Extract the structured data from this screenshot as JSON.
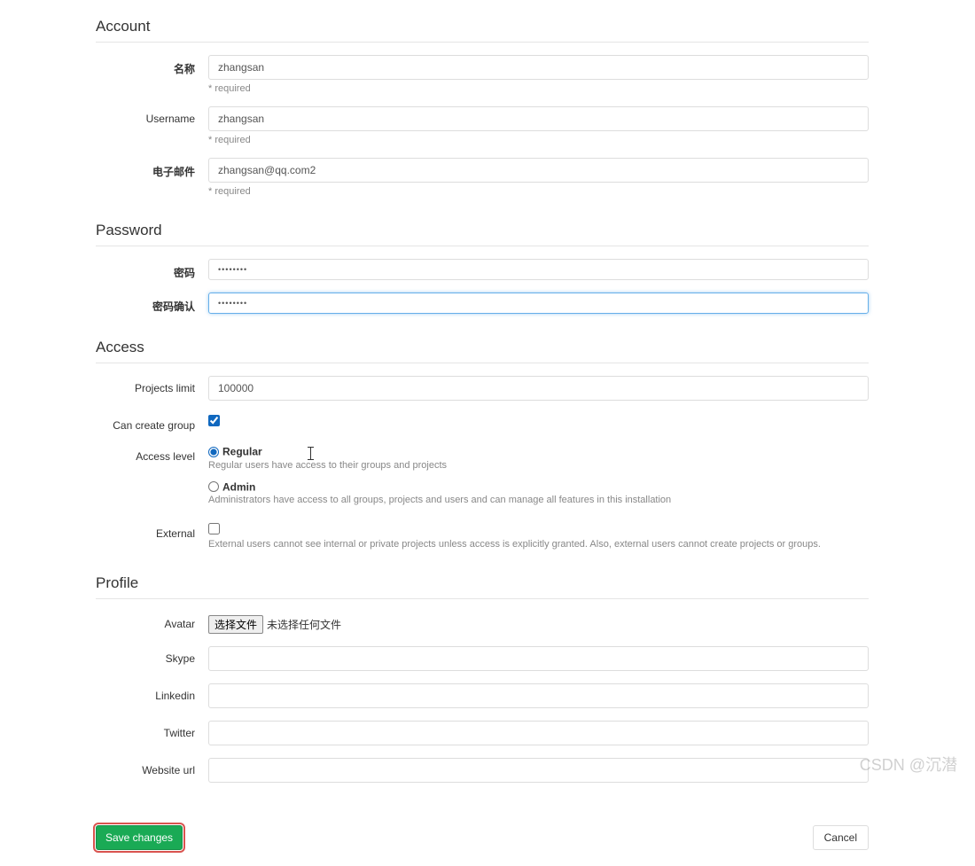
{
  "sections": {
    "account": {
      "title": "Account",
      "name": {
        "label": "名称",
        "value": "zhangsan",
        "required": "* required"
      },
      "username": {
        "label": "Username",
        "value": "zhangsan",
        "required": "* required"
      },
      "email": {
        "label": "电子邮件",
        "value": "zhangsan@qq.com2",
        "required": "* required"
      }
    },
    "password": {
      "title": "Password",
      "pwd": {
        "label": "密码",
        "value": "••••••••"
      },
      "confirm": {
        "label": "密码确认",
        "value": "••••••••"
      }
    },
    "access": {
      "title": "Access",
      "projects_limit": {
        "label": "Projects limit",
        "value": "100000"
      },
      "can_create_group": {
        "label": "Can create group",
        "checked": true
      },
      "access_level": {
        "label": "Access level",
        "regular": {
          "label": "Regular",
          "desc": "Regular users have access to their groups and projects",
          "checked": true
        },
        "admin": {
          "label": "Admin",
          "desc": "Administrators have access to all groups, projects and users and can manage all features in this installation",
          "checked": false
        }
      },
      "external": {
        "label": "External",
        "desc": "External users cannot see internal or private projects unless access is explicitly granted. Also, external users cannot create projects or groups.",
        "checked": false
      }
    },
    "profile": {
      "title": "Profile",
      "avatar": {
        "label": "Avatar",
        "button": "选择文件",
        "text": "未选择任何文件"
      },
      "skype": {
        "label": "Skype",
        "value": ""
      },
      "linkedin": {
        "label": "Linkedin",
        "value": ""
      },
      "twitter": {
        "label": "Twitter",
        "value": ""
      },
      "website": {
        "label": "Website url",
        "value": ""
      }
    }
  },
  "footer": {
    "save": "Save changes",
    "cancel": "Cancel"
  },
  "watermark": "CSDN @沉潜"
}
